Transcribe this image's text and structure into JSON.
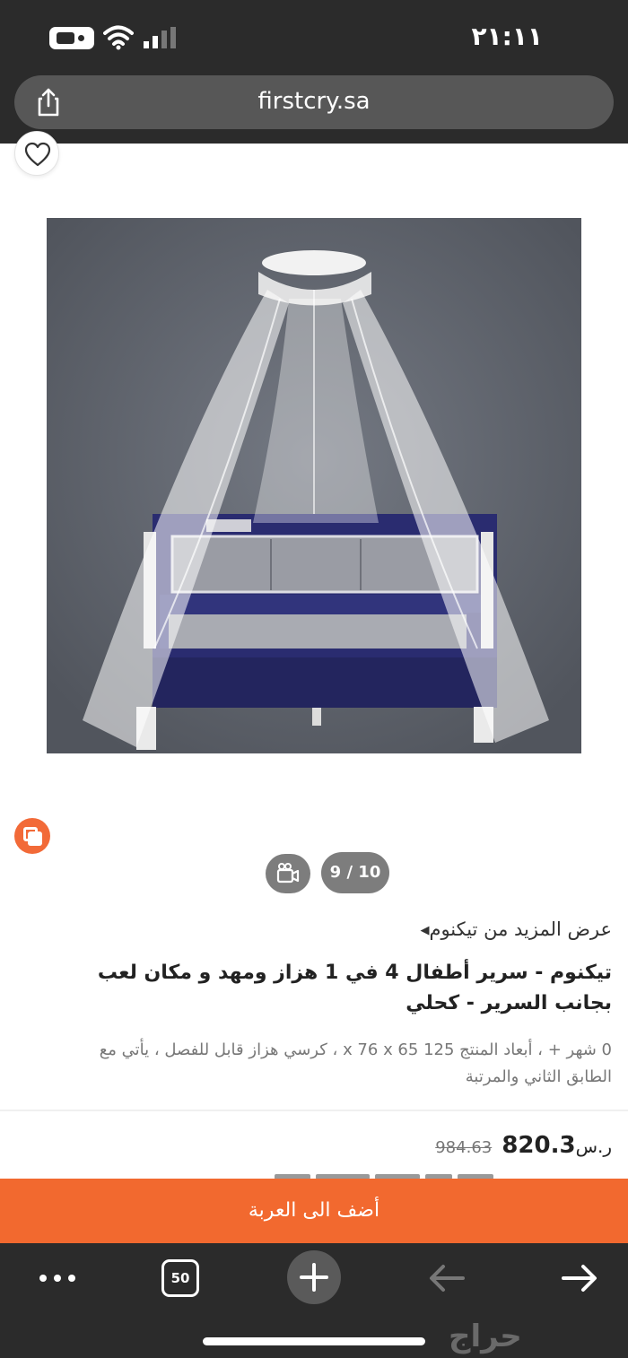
{
  "status_bar": {
    "time": "٢١:١١"
  },
  "browser": {
    "url": "firstcry.sa",
    "tab_count": "50"
  },
  "gallery": {
    "counter": "9 / 10"
  },
  "product": {
    "brand_link": "عرض المزيد من تيكنوم",
    "title": "تيكنوم - سرير أطفال 4 في 1 هزاز ومهد و مكان لعب بجانب السرير - كحلي",
    "description": "0 شهر + ، أبعاد المنتج 125 x 76 x 65 ، كرسي هزاز قابل للفصل ، يأتي مع الطابق الثاني والمرتبة",
    "currency": "ر.س",
    "price": "820.3",
    "old_price": "984.63"
  },
  "cta": {
    "add_to_cart": "أضف الى العربة"
  },
  "watermark": "حراج",
  "colors": {
    "accent": "#f2692f",
    "browser_chrome": "#2b2b2b",
    "crib_navy": "#27296a"
  }
}
